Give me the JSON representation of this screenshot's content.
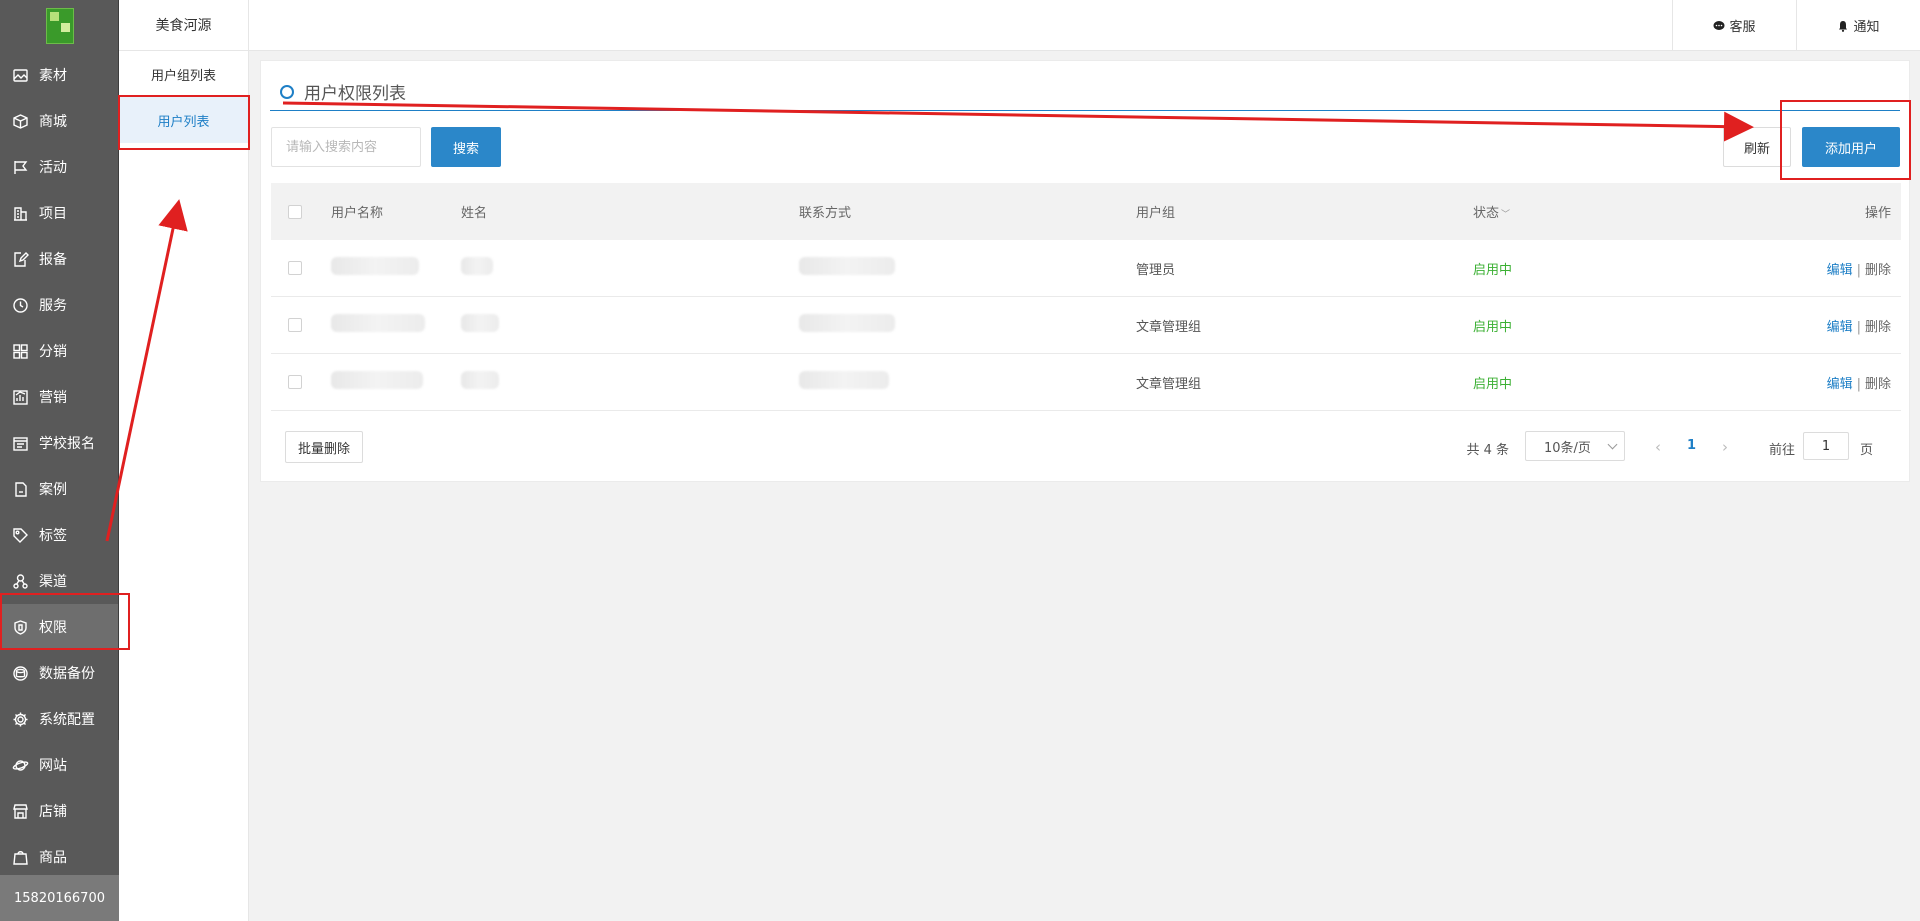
{
  "sidebar": {
    "items": [
      {
        "label": "素材",
        "icon": "image-icon"
      },
      {
        "label": "商城",
        "icon": "box-icon"
      },
      {
        "label": "活动",
        "icon": "flag-icon"
      },
      {
        "label": "项目",
        "icon": "building-icon"
      },
      {
        "label": "报备",
        "icon": "edit-doc-icon"
      },
      {
        "label": "服务",
        "icon": "clock-icon"
      },
      {
        "label": "分销",
        "icon": "grid-icon"
      },
      {
        "label": "营销",
        "icon": "chart-icon"
      },
      {
        "label": "学校报名",
        "icon": "calendar-icon"
      },
      {
        "label": "案例",
        "icon": "file-icon"
      },
      {
        "label": "标签",
        "icon": "tag-icon"
      },
      {
        "label": "渠道",
        "icon": "network-icon"
      },
      {
        "label": "权限",
        "icon": "shield-icon"
      },
      {
        "label": "数据备份",
        "icon": "database-icon"
      },
      {
        "label": "系统配置",
        "icon": "gear-icon"
      },
      {
        "label": "网站",
        "icon": "planet-icon"
      },
      {
        "label": "店铺",
        "icon": "store-icon"
      },
      {
        "label": "商品",
        "icon": "bag-icon"
      }
    ],
    "active_index": 12,
    "user_phone": "15820166700"
  },
  "subside": {
    "title": "美食河源",
    "items": [
      {
        "label": "用户组列表"
      },
      {
        "label": "用户列表"
      }
    ],
    "active_index": 1
  },
  "header": {
    "service_label": "客服",
    "notify_label": "通知"
  },
  "main": {
    "title": "用户权限列表",
    "search": {
      "placeholder": "请输入搜索内容",
      "value": ""
    },
    "search_button": "搜索",
    "refresh_button": "刷新",
    "add_button": "添加用户",
    "columns": {
      "username": "用户名称",
      "name": "姓名",
      "contact": "联系方式",
      "group": "用户组",
      "status": "状态",
      "ops": "操作"
    },
    "rows": [
      {
        "group": "管理员",
        "status": "启用中",
        "edit": "编辑",
        "sep": "|",
        "delete": "删除"
      },
      {
        "group": "文章管理组",
        "status": "启用中",
        "edit": "编辑",
        "sep": "|",
        "delete": "删除"
      },
      {
        "group": "文章管理组",
        "status": "启用中",
        "edit": "编辑",
        "sep": "|",
        "delete": "删除"
      }
    ],
    "batch_delete": "批量删除",
    "pagination": {
      "total": "共 4 条",
      "page_size": "10条/页",
      "current_page": "1",
      "goto_label": "前往",
      "goto_value": "1",
      "page_label": "页"
    }
  },
  "colors": {
    "accent": "#2b87c9",
    "sidebar_bg": "#595959",
    "status_on": "#3cb034",
    "annotation": "#e02020"
  }
}
